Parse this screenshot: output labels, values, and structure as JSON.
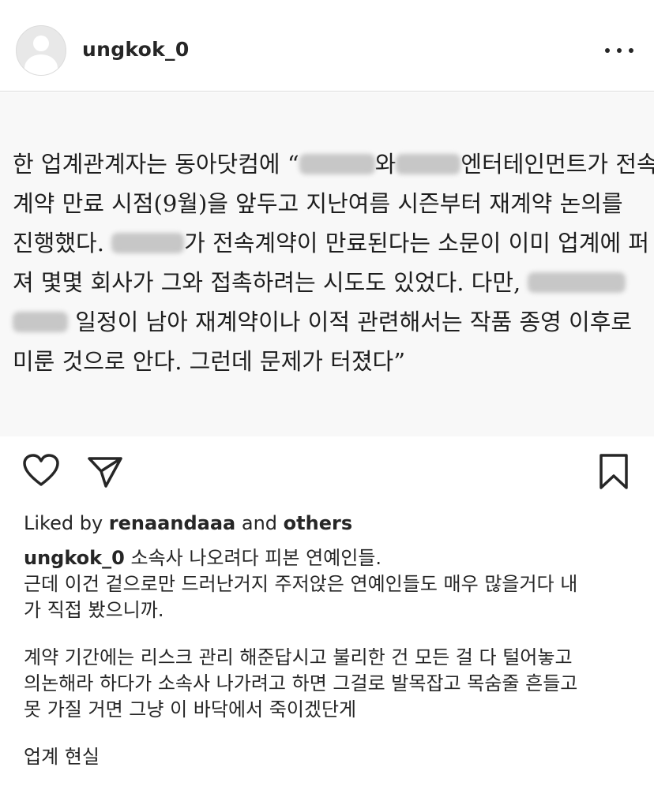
{
  "post": {
    "username": "ungkok_0",
    "more_icon": "more-horizontal-icon"
  },
  "image_text": {
    "lines": [
      {
        "parts": [
          "한 업계관계자는 동아닷컴에 “",
          "[redacted]",
          "와",
          "[redacted]",
          "엔터테인먼트가 전속"
        ]
      },
      {
        "parts": [
          "계약 만료 시점(9월)을 앞두고 지난여름 시즌부터 재계약 논의를"
        ]
      },
      {
        "parts": [
          "진행했다. ",
          "[redacted]",
          "가 전속계약이 만료된다는 소문이 이미 업계에 퍼"
        ]
      },
      {
        "parts": [
          "져 몇몇 회사가 그와 접촉하려는 시도도 있었다. 다만, ",
          "[redacted]"
        ]
      },
      {
        "parts": [
          "[redacted]",
          " 일정이 남아 재계약이나 이적 관련해서는 작품 종영 이후로"
        ]
      },
      {
        "parts": [
          "미룬 것으로 안다. 그런데 문제가 터졌다”"
        ]
      }
    ]
  },
  "actions": {
    "like_icon": "heart-icon",
    "share_icon": "send-icon",
    "save_icon": "bookmark-icon"
  },
  "likes": {
    "prefix": "Liked by ",
    "user": "renaandaaa",
    "middle": " and ",
    "others": "others"
  },
  "caption": {
    "username": "ungkok_0",
    "first_line": " 소속사 나오려다 피본 연예인들.",
    "lines": [
      "근데 이건 겉으로만 드러난거지 주저앉은 연예인들도 매우 많을거다 내",
      "가 직접 봤으니까.",
      "",
      "계약 기간에는 리스크 관리 해준답시고 불리한 건 모든 걸 다 털어놓고",
      "의논해라 하다가 소속사 나가려고 하면 그걸로 발목잡고 목숨줄 흔들고",
      "못 가질 거면 그냥 이 바닥에서 죽이겠단게",
      "",
      "업계 현실"
    ]
  }
}
